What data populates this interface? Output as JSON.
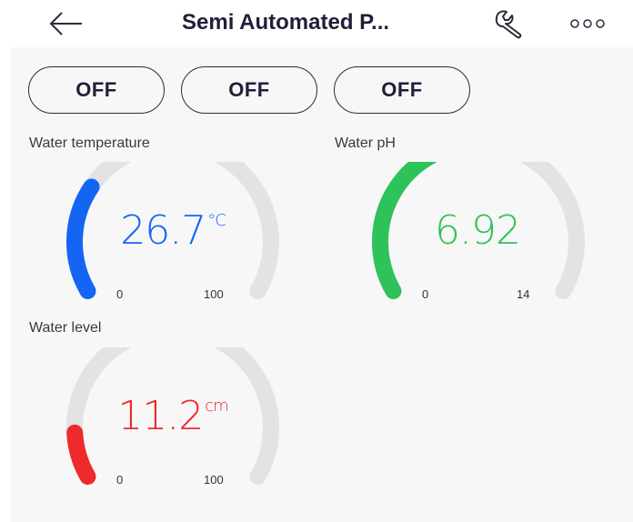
{
  "header": {
    "title": "Semi Automated P...",
    "back_icon": "arrow-left-icon",
    "settings_icon": "wrench-icon",
    "more_icon": "more-horizontal-icon"
  },
  "switches": [
    {
      "label": "OFF"
    },
    {
      "label": "OFF"
    },
    {
      "label": "OFF"
    }
  ],
  "gauges": {
    "temperature": {
      "label": "Water temperature",
      "value": "26.7",
      "unit": "°C",
      "min": "0",
      "max": "100",
      "fraction": 0.267,
      "color": "#1565f5"
    },
    "ph": {
      "label": "Water pH",
      "value": "6.92",
      "unit": "",
      "min": "0",
      "max": "14",
      "fraction": 0.494,
      "color": "#2ec25a"
    },
    "level": {
      "label": "Water level",
      "value": "11.2",
      "unit": "cm",
      "min": "0",
      "max": "100",
      "fraction": 0.112,
      "color": "#ee2a2a"
    }
  },
  "colors": {
    "track": "#e3e3e3",
    "text_dark": "#1f1f3a",
    "background": "#f7f7f7"
  }
}
